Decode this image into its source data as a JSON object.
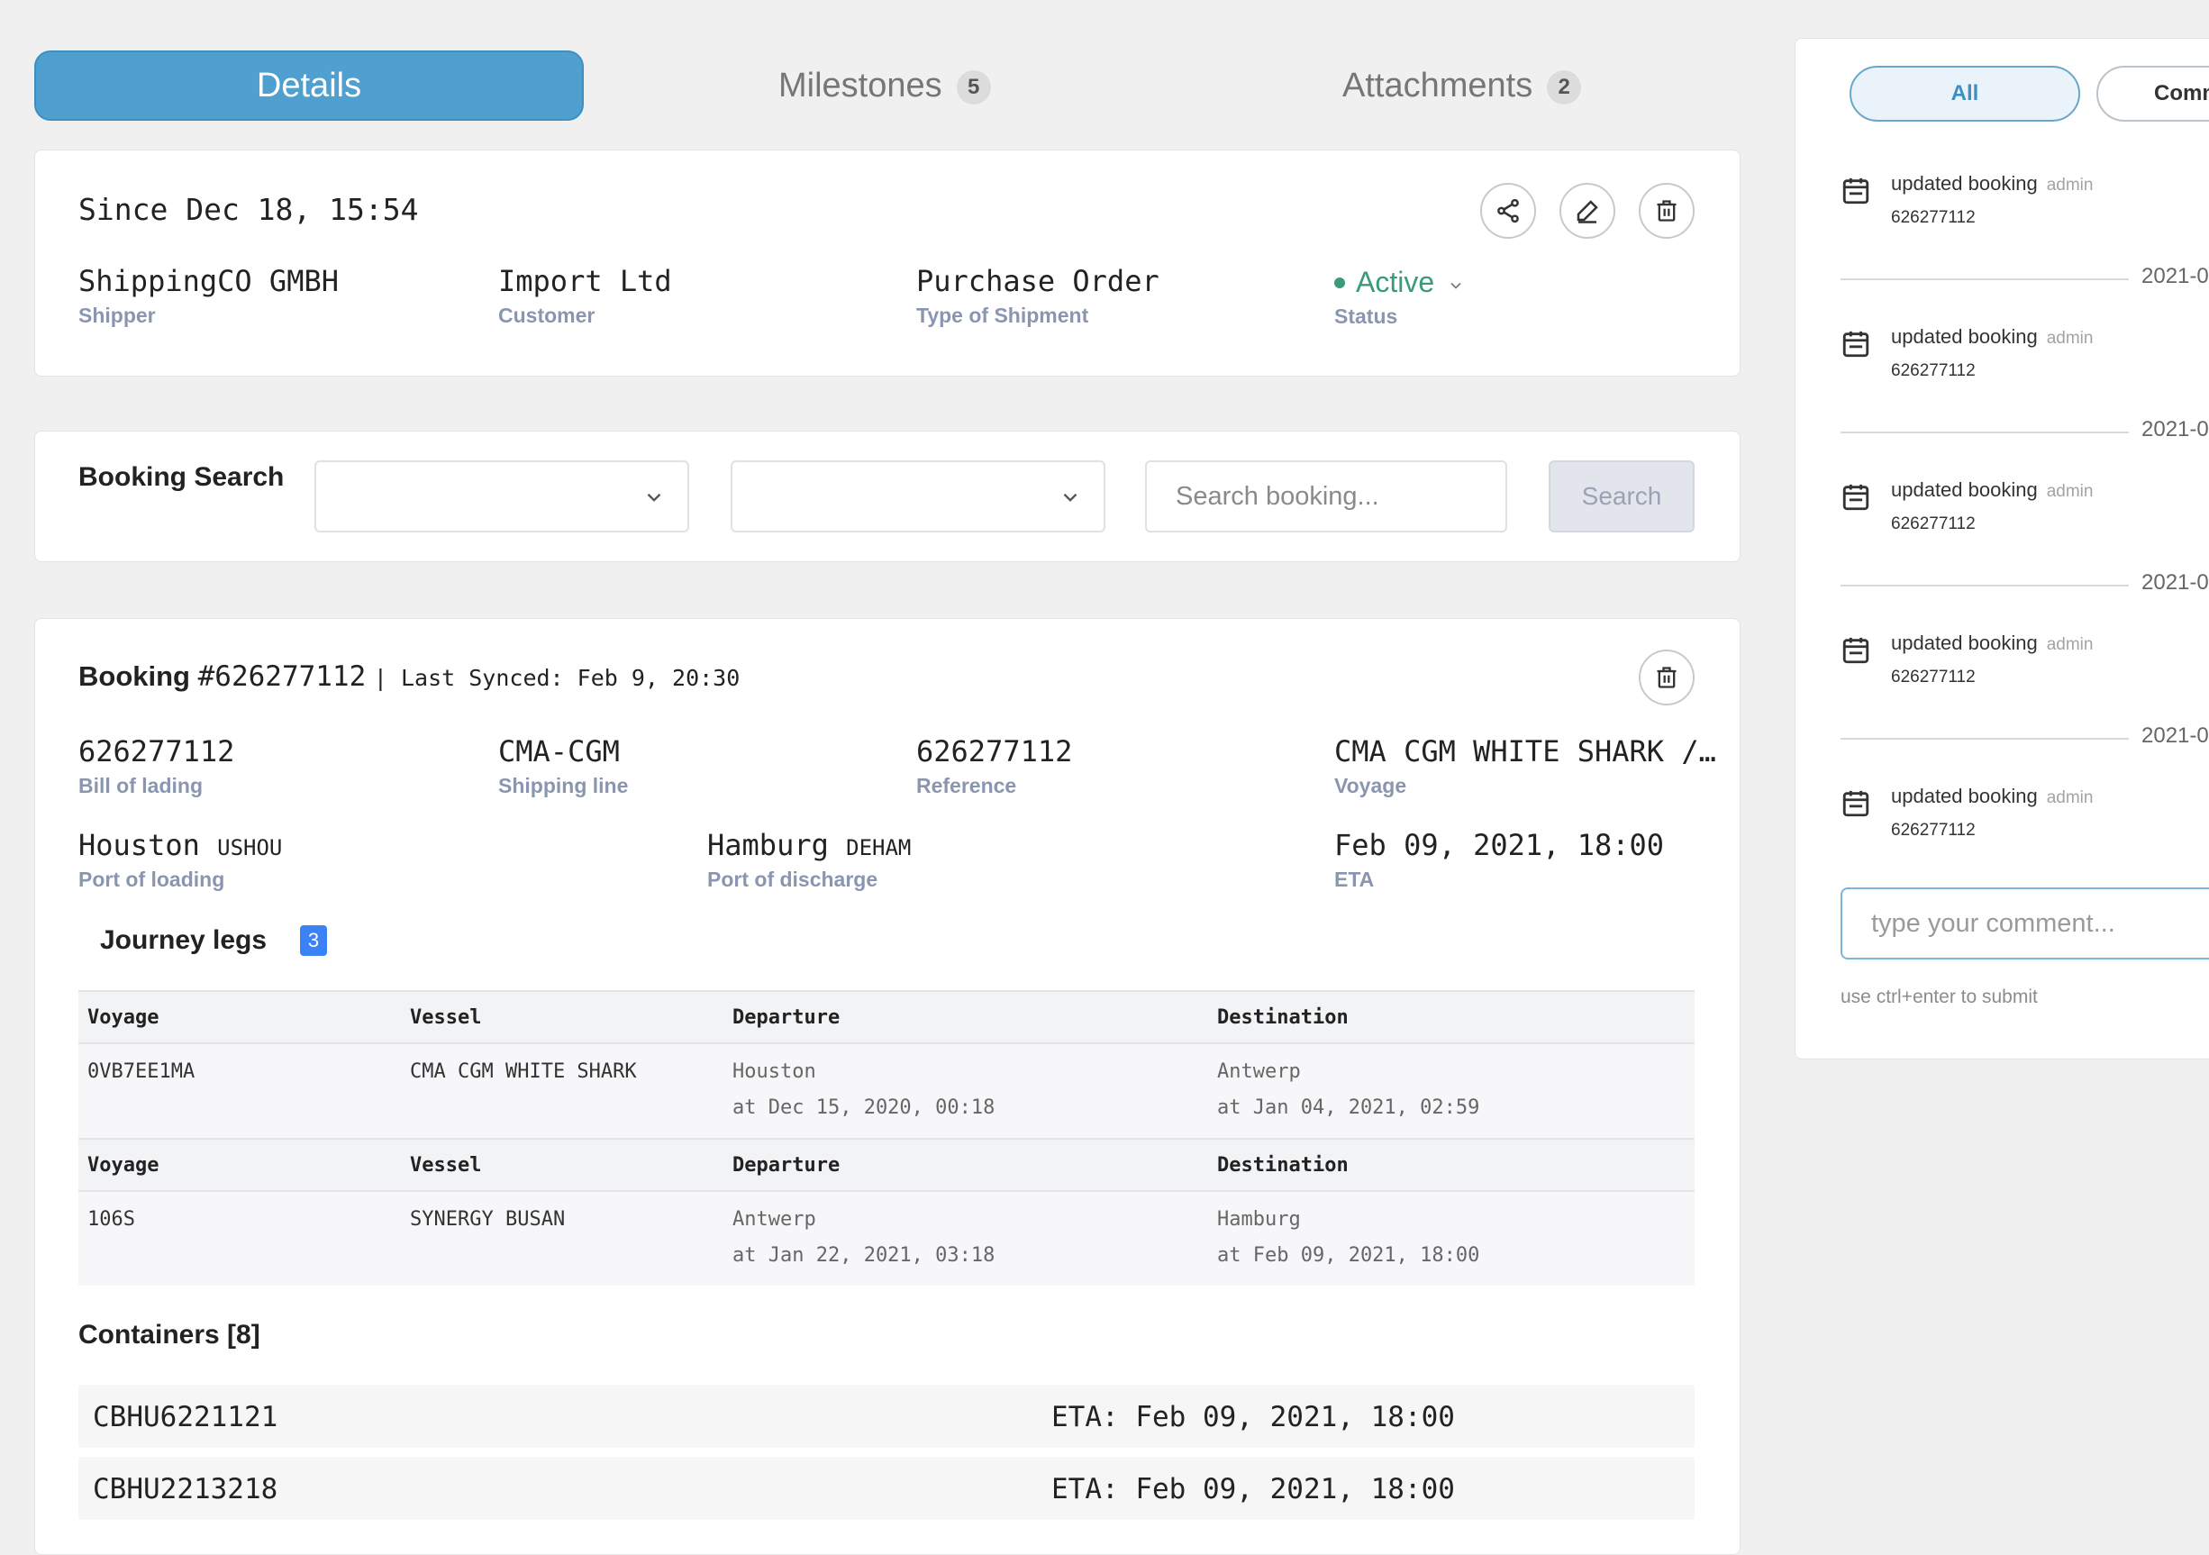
{
  "tabs": {
    "details": "Details",
    "milestones": "Milestones",
    "milestones_count": "5",
    "attachments": "Attachments",
    "attachments_count": "2"
  },
  "summary": {
    "since": "Since Dec 18, 15:54",
    "shipper": {
      "value": "ShippingCO GMBH",
      "label": "Shipper"
    },
    "customer": {
      "value": "Import Ltd",
      "label": "Customer"
    },
    "type": {
      "value": "Purchase Order",
      "label": "Type of Shipment"
    },
    "status": {
      "value": "Active",
      "label": "Status",
      "color": "#3a9a7e"
    }
  },
  "booking_search": {
    "title": "Booking Search",
    "placeholder": "Search booking...",
    "button": "Search"
  },
  "booking": {
    "title_bold": "Booking",
    "number": "#626277112",
    "sync": "| Last Synced: Feb 9, 20:30",
    "bill": {
      "value": "626277112",
      "label": "Bill of lading"
    },
    "line": {
      "value": "CMA-CGM",
      "label": "Shipping line"
    },
    "reference": {
      "value": "626277112",
      "label": "Reference"
    },
    "voyage": {
      "value": "CMA CGM WHITE SHARK /…",
      "label": "Voyage"
    },
    "pol": {
      "value": "Houston",
      "code": "USHOU",
      "label": "Port of loading"
    },
    "pod": {
      "value": "Hamburg",
      "code": "DEHAM",
      "label": "Port of discharge"
    },
    "eta": {
      "value": "Feb 09, 2021, 18:00",
      "label": "ETA"
    }
  },
  "journey": {
    "title": "Journey legs",
    "count": "3",
    "headers": {
      "voyage": "Voyage",
      "vessel": "Vessel",
      "departure": "Departure",
      "destination": "Destination"
    },
    "legs": [
      {
        "voyage": "0VB7EE1MA",
        "vessel": "CMA CGM WHITE SHARK",
        "dep_place": "Houston",
        "dep_time": "at Dec 15, 2020, 00:18",
        "dest_place": "Antwerp",
        "dest_time": "at Jan 04, 2021, 02:59"
      },
      {
        "voyage": "106S",
        "vessel": "SYNERGY BUSAN",
        "dep_place": "Antwerp",
        "dep_time": "at Jan 22, 2021, 03:18",
        "dest_place": "Hamburg",
        "dest_time": "at Feb 09, 2021, 18:00"
      }
    ]
  },
  "containers": {
    "title": "Containers [8]",
    "rows": [
      {
        "id": "CBHU6221121",
        "eta": "ETA: Feb 09, 2021, 18:00"
      },
      {
        "id": "CBHU2213218",
        "eta": "ETA: Feb 09, 2021, 18:00"
      }
    ]
  },
  "sidebar": {
    "filter_all": "All",
    "filter_comments": "Comm",
    "activities": [
      {
        "text": "updated booking",
        "user": "admin",
        "num": "626277112"
      },
      {
        "text": "updated booking",
        "user": "admin",
        "num": "626277112"
      },
      {
        "text": "updated booking",
        "user": "admin",
        "num": "626277112"
      },
      {
        "text": "updated booking",
        "user": "admin",
        "num": "626277112"
      },
      {
        "text": "updated booking",
        "user": "admin",
        "num": "626277112"
      }
    ],
    "dates": [
      "2021-0",
      "2021-0",
      "2021-0",
      "2021-0"
    ],
    "comment_placeholder": "type your comment...",
    "hint": "use ctrl+enter to submit"
  }
}
